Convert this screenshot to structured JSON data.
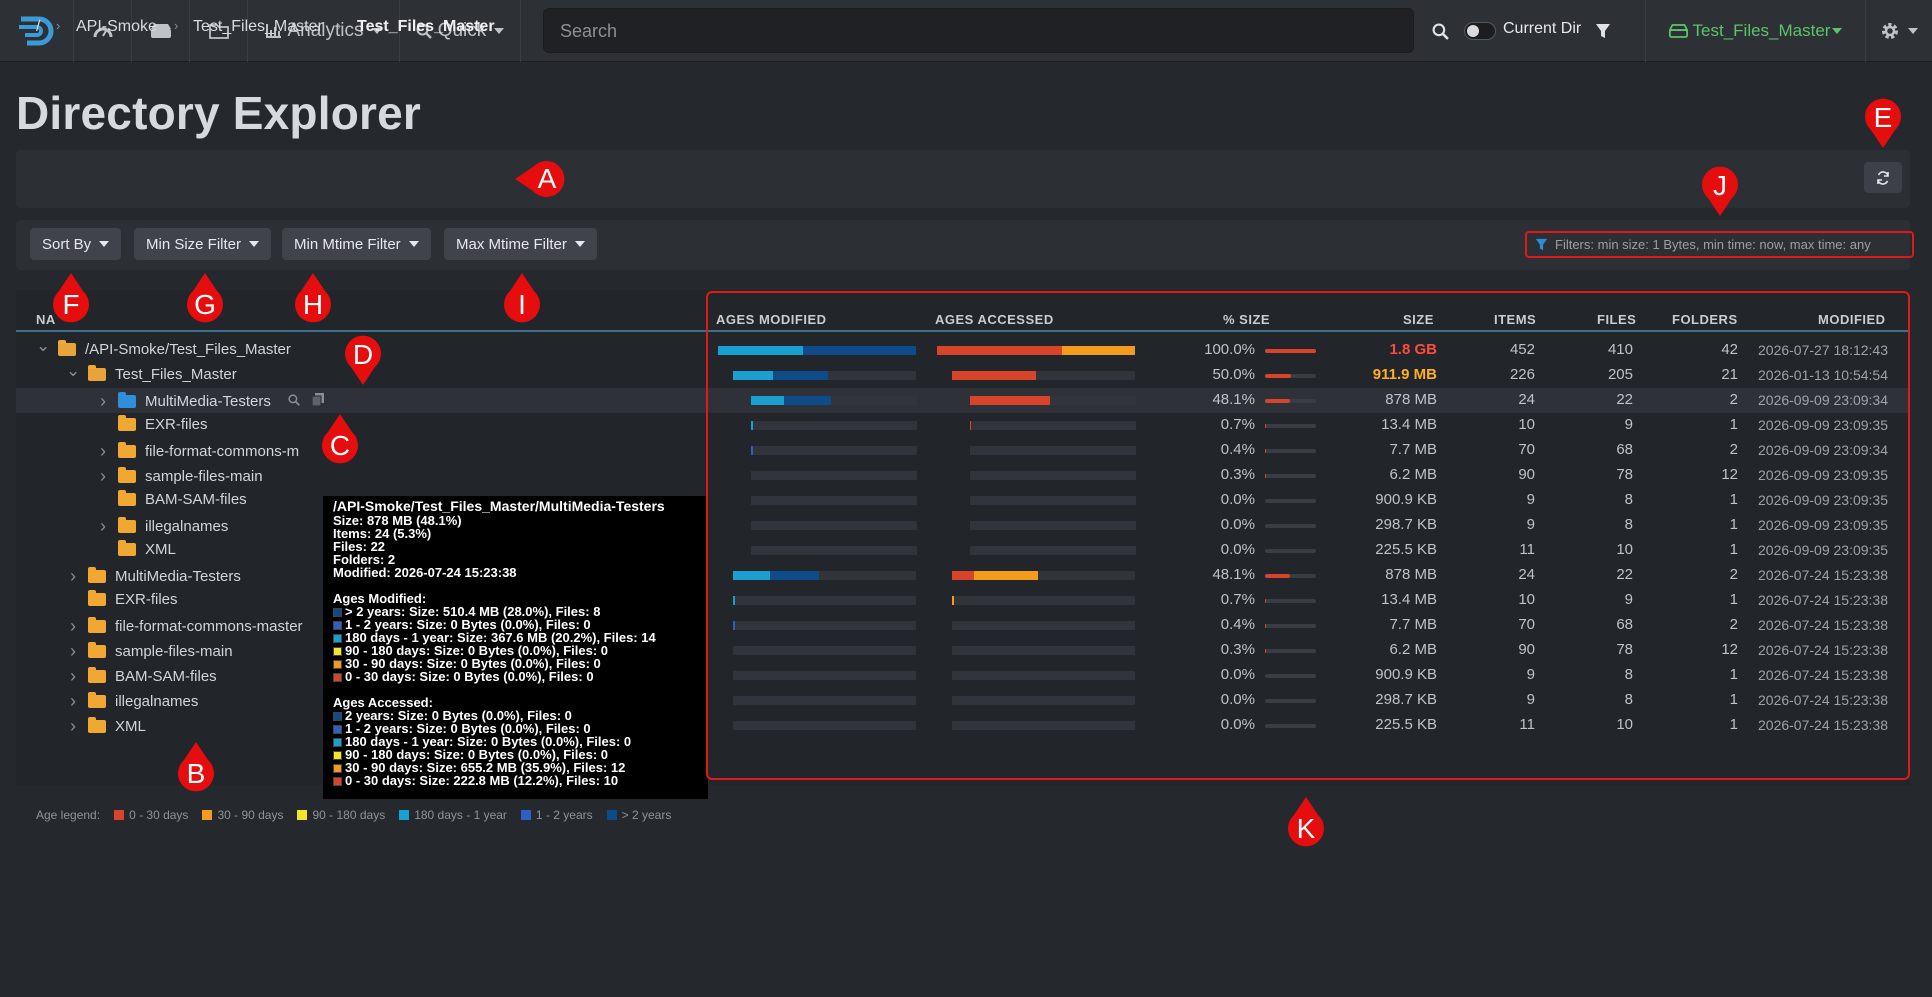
{
  "nav": {
    "analytics_label": "Analytics",
    "quick_label": "Quick",
    "search_placeholder": "Search",
    "current_dir_label": "Current Dir",
    "index_label": "Test_Files_Master"
  },
  "page": {
    "title": "Directory Explorer"
  },
  "breadcrumb": {
    "root": "/",
    "items": [
      "API-Smoke",
      "Test_Files_Master",
      "Test_Files_Master"
    ]
  },
  "toolbar": {
    "sort_by": "Sort By",
    "min_size": "Min Size Filter",
    "min_mtime": "Min Mtime Filter",
    "max_mtime": "Max Mtime Filter",
    "filter_info": "Filters: min size: 1 Bytes, min time: now, max time: any"
  },
  "table": {
    "name_header": "NA",
    "headers": {
      "ages_modified": "AGES MODIFIED",
      "ages_accessed": "AGES ACCESSED",
      "pct_size": "% SIZE",
      "size": "SIZE",
      "items": "ITEMS",
      "files": "FILES",
      "folders": "FOLDERS",
      "modified": "MODIFIED"
    },
    "rows": [
      {
        "name": "/API-Smoke/Test_Files_Master",
        "pct": "100.0%",
        "pct_val": 100,
        "size": "1.8 GB",
        "items": "452",
        "files": "410",
        "folders": "42",
        "modified": "2026-07-27 18:12:43"
      },
      {
        "name": "Test_Files_Master",
        "pct": "50.0%",
        "pct_val": 50,
        "size": "911.9 MB",
        "items": "226",
        "files": "205",
        "folders": "21",
        "modified": "2026-01-13 10:54:54"
      },
      {
        "name": "MultiMedia-Testers",
        "pct": "48.1%",
        "pct_val": 48.1,
        "size": "878 MB",
        "items": "24",
        "files": "22",
        "folders": "2",
        "modified": "2026-09-09 23:09:34"
      },
      {
        "name": "EXR-files",
        "pct": "0.7%",
        "pct_val": 0.7,
        "size": "13.4 MB",
        "items": "10",
        "files": "9",
        "folders": "1",
        "modified": "2026-09-09 23:09:35"
      },
      {
        "name": "file-format-commons-m",
        "pct": "0.4%",
        "pct_val": 0.4,
        "size": "7.7 MB",
        "items": "70",
        "files": "68",
        "folders": "2",
        "modified": "2026-09-09 23:09:34"
      },
      {
        "name": "sample-files-main",
        "pct": "0.3%",
        "pct_val": 0.3,
        "size": "6.2 MB",
        "items": "90",
        "files": "78",
        "folders": "12",
        "modified": "2026-09-09 23:09:35"
      },
      {
        "name": "BAM-SAM-files",
        "pct": "0.0%",
        "pct_val": 0,
        "size": "900.9 KB",
        "items": "9",
        "files": "8",
        "folders": "1",
        "modified": "2026-09-09 23:09:35"
      },
      {
        "name": "illegalnames",
        "pct": "0.0%",
        "pct_val": 0,
        "size": "298.7 KB",
        "items": "9",
        "files": "8",
        "folders": "1",
        "modified": "2026-09-09 23:09:35"
      },
      {
        "name": "XML",
        "pct": "0.0%",
        "pct_val": 0,
        "size": "225.5 KB",
        "items": "11",
        "files": "10",
        "folders": "1",
        "modified": "2026-09-09 23:09:35"
      },
      {
        "name": "MultiMedia-Testers",
        "pct": "48.1%",
        "pct_val": 48.1,
        "size": "878 MB",
        "items": "24",
        "files": "22",
        "folders": "2",
        "modified": "2026-07-24 15:23:38"
      },
      {
        "name": "EXR-files",
        "pct": "0.7%",
        "pct_val": 0.7,
        "size": "13.4 MB",
        "items": "10",
        "files": "9",
        "folders": "1",
        "modified": "2026-07-24 15:23:38"
      },
      {
        "name": "file-format-commons-master",
        "pct": "0.4%",
        "pct_val": 0.4,
        "size": "7.7 MB",
        "items": "70",
        "files": "68",
        "folders": "2",
        "modified": "2026-07-24 15:23:38"
      },
      {
        "name": "sample-files-main",
        "pct": "0.3%",
        "pct_val": 0.3,
        "size": "6.2 MB",
        "items": "90",
        "files": "78",
        "folders": "12",
        "modified": "2026-07-24 15:23:38"
      },
      {
        "name": "BAM-SAM-files",
        "pct": "0.0%",
        "pct_val": 0,
        "size": "900.9 KB",
        "items": "9",
        "files": "8",
        "folders": "1",
        "modified": "2026-07-24 15:23:38"
      },
      {
        "name": "illegalnames",
        "pct": "0.0%",
        "pct_val": 0,
        "size": "298.7 KB",
        "items": "9",
        "files": "8",
        "folders": "1",
        "modified": "2026-07-24 15:23:38"
      },
      {
        "name": "XML",
        "pct": "0.0%",
        "pct_val": 0,
        "size": "225.5 KB",
        "items": "11",
        "files": "10",
        "folders": "1",
        "modified": "2026-07-24 15:23:38"
      }
    ]
  },
  "tooltip": {
    "title": "/API-Smoke/Test_Files_Master/MultiMedia-Testers",
    "size": "Size: 878 MB (48.1%)",
    "items": "Items: 24 (5.3%)",
    "files": "Files: 22",
    "folders": "Folders: 2",
    "modified": "Modified: 2026-07-24 15:23:38",
    "ages_modified_title": "Ages Modified:",
    "ages_modified": [
      "> 2 years: Size: 510.4 MB (28.0%), Files: 8",
      "1 - 2 years: Size: 0 Bytes (0.0%), Files: 0",
      "180 days - 1 year: Size: 367.6 MB (20.2%), Files: 14",
      "90 - 180 days: Size: 0 Bytes (0.0%), Files: 0",
      "30 - 90 days: Size: 0 Bytes (0.0%), Files: 0",
      "0 - 30 days: Size: 0 Bytes (0.0%), Files: 0"
    ],
    "ages_accessed_title": "Ages Accessed:",
    "ages_accessed": [
      "2 years: Size: 0 Bytes (0.0%), Files: 0",
      "1 - 2 years: Size: 0 Bytes (0.0%), Files: 0",
      "180 days - 1 year: Size: 0 Bytes (0.0%), Files: 0",
      "90 - 180 days: Size: 0 Bytes (0.0%), Files: 0",
      "30 - 90 days: Size: 655.2 MB (35.9%), Files: 12",
      "0 - 30 days: Size: 222.8 MB (12.2%), Files: 10"
    ]
  },
  "legend": {
    "title": "Age legend:",
    "items": [
      "0 - 30 days",
      "30 - 90 days",
      "90 - 180 days",
      "180 days - 1 year",
      "1 - 2 years",
      "> 2 years"
    ],
    "colors": [
      "#d7442a",
      "#f29b1d",
      "#f5e52a",
      "#1a9fd1",
      "#2f5fc0",
      "#0d4b8a"
    ]
  },
  "behind_tooltip": {
    "legend_fragment": "1 - 2 years"
  },
  "annotations": [
    "A",
    "B",
    "C",
    "D",
    "E",
    "F",
    "G",
    "H",
    "I",
    "J",
    "K"
  ],
  "colors": {
    "accent_red": "#e01a1a",
    "size_total": "#ff4b3a",
    "size_second": "#ffb020",
    "index_green": "#5cc46a"
  }
}
